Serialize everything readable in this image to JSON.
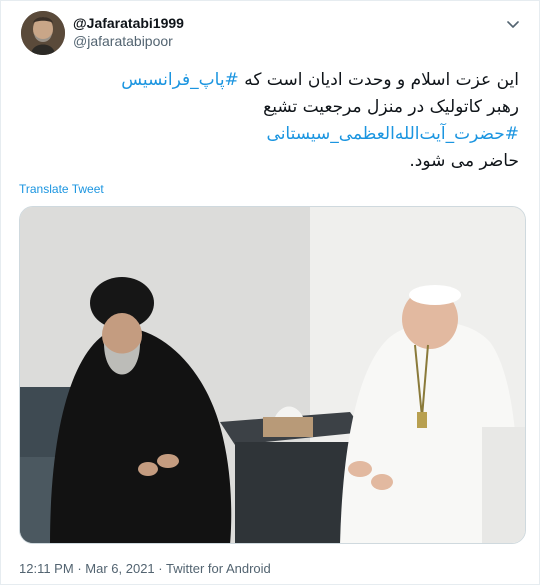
{
  "tweet": {
    "display_name": "@Jafaratabi1999",
    "handle": "@jafaratabipoor",
    "text_line1_plain": "این عزت اسلام و وحدت ادیان است که ",
    "text_line1_hashtag": "#پاپ_فرانسیس",
    "text_line2": "رهبر کاتولیک در منزل مرجعیت تشیع",
    "text_line3_hashtag": "#حضرت_آیت‌الله‌العظمی_سیستانی",
    "text_line4": "حاضر می شود.",
    "translate_label": "Translate Tweet",
    "time": "12:11 PM",
    "date": "Mar 6, 2021",
    "source": "Twitter for Android",
    "separator": "·"
  },
  "icons": {
    "menu": "chevron-down-icon",
    "avatar": "profile-photo"
  },
  "colors": {
    "link": "#1b95e0",
    "text": "#0f1419",
    "secondary": "#536471",
    "border": "#e6ecf0"
  }
}
